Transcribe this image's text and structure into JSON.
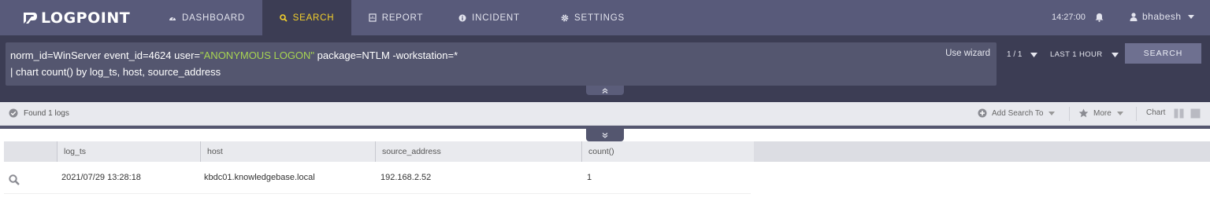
{
  "app": {
    "brand": "LOGPOINT"
  },
  "nav": {
    "items": [
      {
        "label": "DASHBOARD",
        "icon": "dashboard-icon"
      },
      {
        "label": "SEARCH",
        "icon": "search-icon"
      },
      {
        "label": "REPORT",
        "icon": "report-icon"
      },
      {
        "label": "INCIDENT",
        "icon": "incident-icon"
      },
      {
        "label": "SETTINGS",
        "icon": "settings-icon"
      }
    ],
    "active": "SEARCH"
  },
  "header": {
    "time": "14:27:00",
    "username": "bhabesh"
  },
  "search": {
    "query_line1_prefix": "norm_id=WinServer event_id=4624 user=",
    "query_line1_highlight": "\"ANONYMOUS LOGON\"",
    "query_line1_suffix": " package=NTLM -workstation=*",
    "query_line2": "| chart count() by log_ts, host, source_address",
    "wizard_label": "Use wizard",
    "page": "1 / 1",
    "time_range": "LAST 1 HOUR",
    "button_label": "SEARCH"
  },
  "results": {
    "found_text": "Found 1 logs",
    "add_search_label": "Add Search To",
    "more_label": "More",
    "chart_label": "Chart"
  },
  "table": {
    "columns": [
      "",
      "log_ts",
      "host",
      "source_address",
      "count()"
    ],
    "rows": [
      {
        "log_ts": "2021/07/29 13:28:18",
        "host": "kbdc01.knowledgebase.local",
        "source_address": "192.168.2.52",
        "count": "1"
      }
    ]
  },
  "colors": {
    "nav_bg": "#585a7a",
    "search_band_bg": "#3c3d54",
    "active_accent": "#f3d02b",
    "query_highlight": "#a8d552"
  }
}
